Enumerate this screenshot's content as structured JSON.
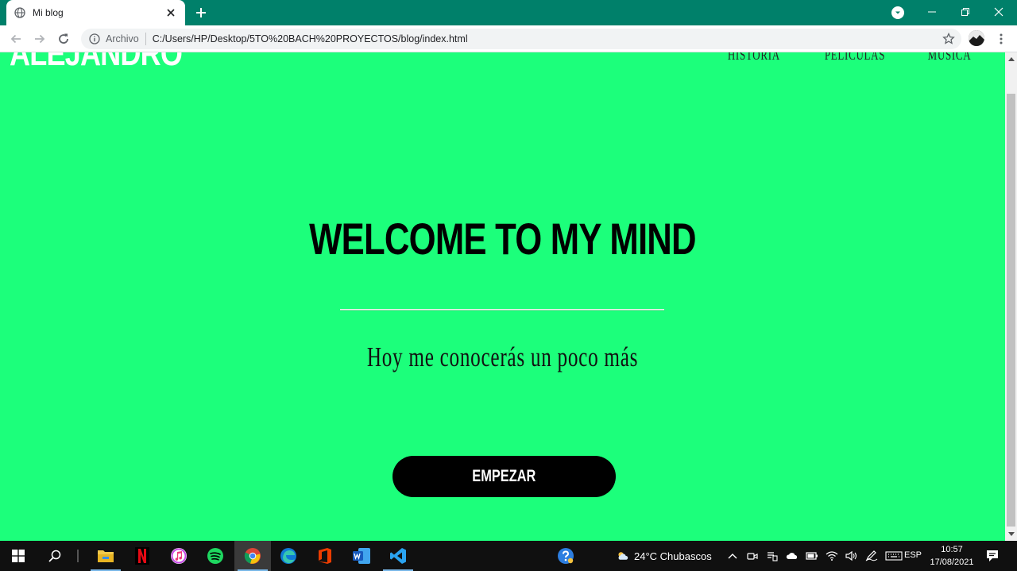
{
  "browser": {
    "tab_title": "Mi blog",
    "address_scheme": "Archivo",
    "address_url": "C:/Users/HP/Desktop/5TO%20BACH%20PROYECTOS/blog/index.html",
    "titlebar_color": "#00806a"
  },
  "page": {
    "logo": "ALEJANDRO",
    "nav": [
      "HISTORIA",
      "PELÍCULAS",
      "MÚSICA"
    ],
    "hero_title": "WELCOME TO MY MIND",
    "hero_subtitle": "Hoy me conocerás un poco más",
    "cta_label": "EMPEZAR",
    "background_color": "#1cff7b"
  },
  "taskbar": {
    "apps": [
      "windows-start",
      "search",
      "file-explorer",
      "netflix",
      "itunes",
      "spotify",
      "chrome",
      "edge",
      "office",
      "word",
      "vscode"
    ],
    "weather": "24°C  Chubascos",
    "language": "ESP",
    "time": "10:57",
    "date": "17/08/2021"
  }
}
